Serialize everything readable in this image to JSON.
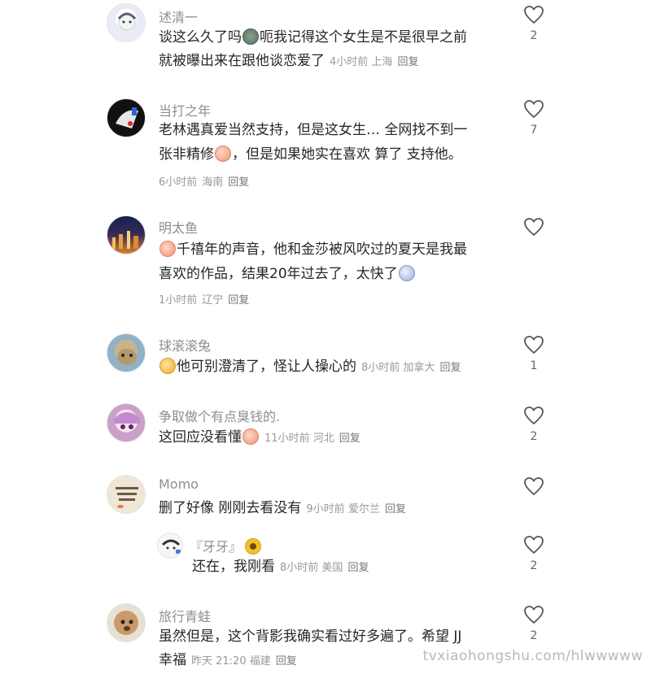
{
  "comments": [
    {
      "username": "述清一",
      "line1": "谈这么久了吗",
      "line1_emoji": "cat-emoji",
      "line1_rest": "呃我记得这个女生是不是很早之前",
      "line2": "就被曝出来在跟他谈恋爱了",
      "time": "4小时前",
      "location": "上海",
      "reply_label": "回复",
      "likes": "2"
    },
    {
      "username": "当打之年",
      "line1": "老林遇真爱当然支持，但是这女生… 全网找不到一",
      "line2_pre": "张非精修",
      "line2_emoji": "crying-emoji",
      "line2_rest": "，但是如果她实在喜欢 算了 支持他。",
      "time": "6小时前",
      "location": "海南",
      "reply_label": "回复",
      "likes": "7"
    },
    {
      "username": "明太鱼",
      "line1_emoji": "crying-emoji",
      "line1": "千禧年的声音，他和金莎被风吹过的夏天是我最",
      "line2": "喜欢的作品，结果20年过去了，太快了",
      "line2_emoji": "sad-emoji",
      "time": "1小时前",
      "location": "辽宁",
      "reply_label": "回复",
      "likes": ""
    },
    {
      "username": "球滚滚兔",
      "line1_emoji": "gold-emoji",
      "line1": "他可别澄清了，怪让人操心的",
      "time": "8小时前",
      "location": "加拿大",
      "reply_label": "回复",
      "likes": "1"
    },
    {
      "username": "争取做个有点臭钱的.",
      "line1": "这回应没看懂",
      "line1_emoji": "crying-emoji",
      "time": "11小时前",
      "location": "河北",
      "reply_label": "回复",
      "likes": "2"
    },
    {
      "username": "Momo",
      "line1": "删了好像 刚刚去看没有",
      "time": "9小时前",
      "location": "爱尔兰",
      "reply_label": "回复",
      "likes": ""
    },
    {
      "username": "『牙牙』",
      "username_emoji": "sunflower-emoji",
      "line1": "还在，我刚看",
      "time": "8小时前",
      "location": "美国",
      "reply_label": "回复",
      "likes": "2"
    },
    {
      "username": "旅行青蛙",
      "line1": "虽然但是，这个背影我确实看过好多遍了。希望 JJ",
      "line2": "幸福",
      "time": "昨天 21:20",
      "location": "福建",
      "reply_label": "回复",
      "likes": "2"
    }
  ],
  "watermark": "tvxiaohongshu.com/hlwwwww",
  "colors": {
    "text": "#262626",
    "muted": "#999999",
    "username": "#8e8e8e"
  }
}
